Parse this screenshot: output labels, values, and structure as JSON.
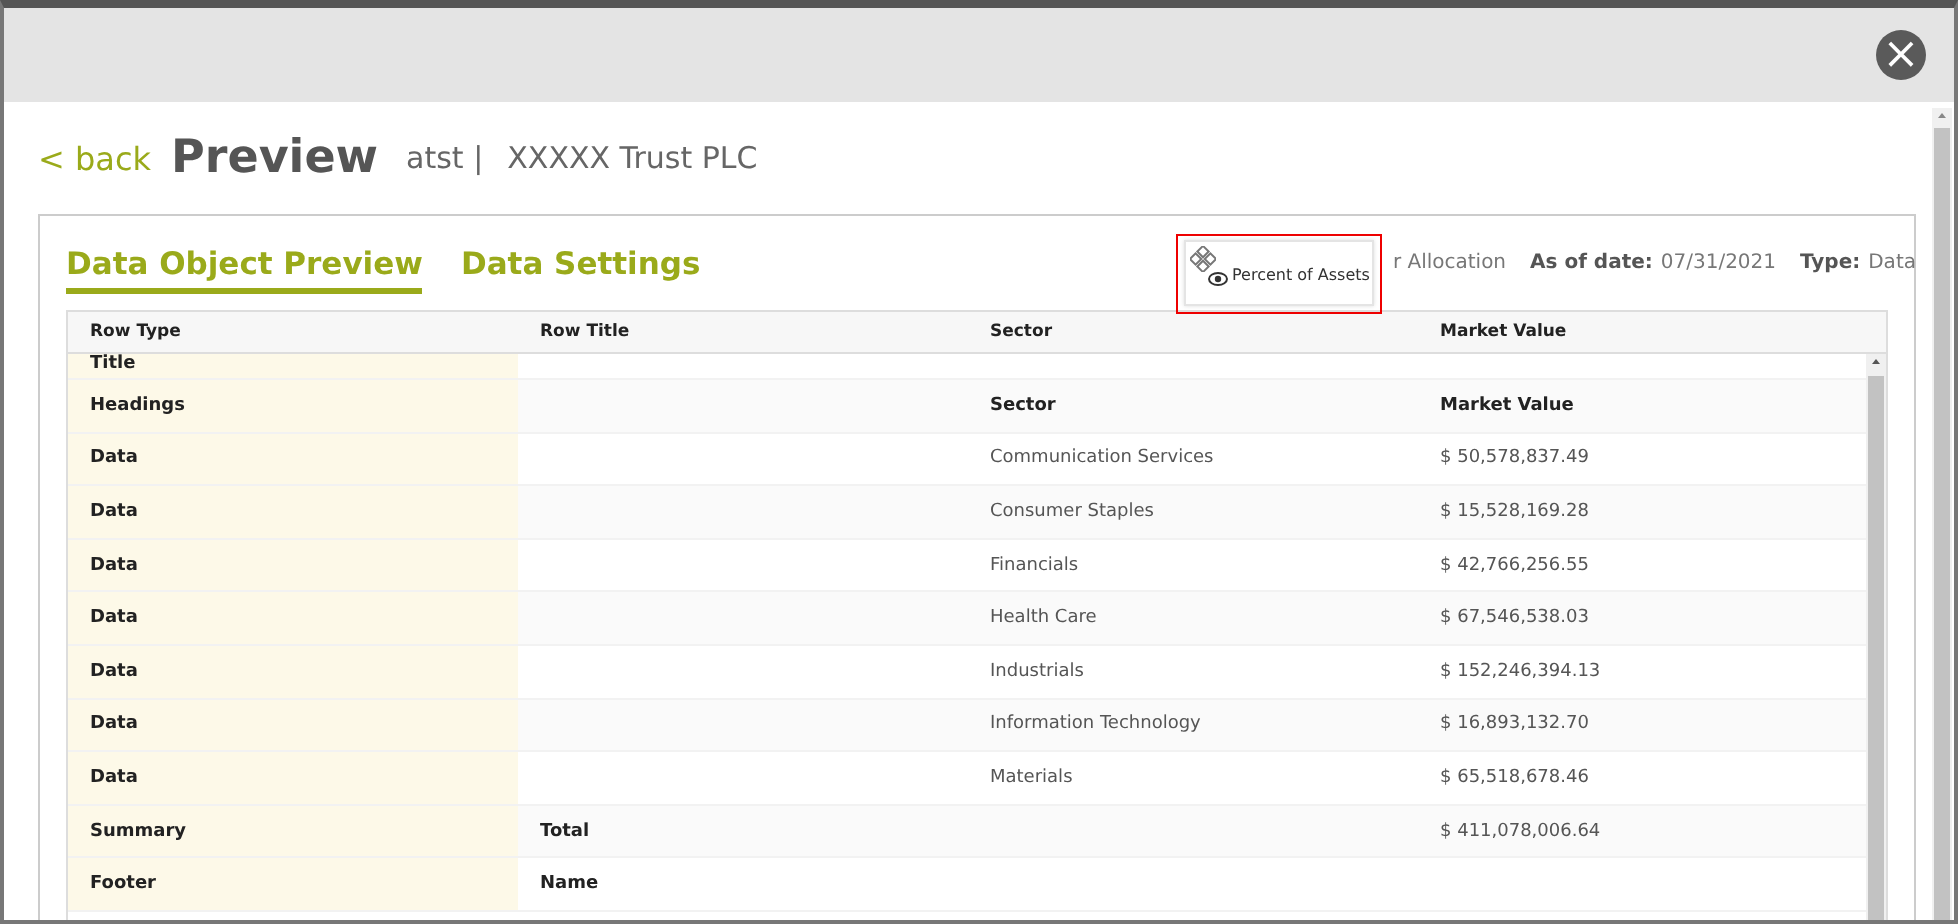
{
  "header": {
    "close_label": "×"
  },
  "page": {
    "back": "< back",
    "title": "Preview",
    "subtitle": "atst |",
    "entity": "XXXXX  Trust PLC"
  },
  "tabs": [
    {
      "label": "Data Object Preview",
      "selected": true
    },
    {
      "label": "Data Settings",
      "selected": false
    }
  ],
  "info": {
    "partial_label": "r Allocation",
    "date_label": "As of date:",
    "date": "07/31/2021",
    "type_label": "Type:",
    "type": "Data"
  },
  "tooltip": {
    "text": "Percent of Assets",
    "highlighted": true
  },
  "table": {
    "columns": [
      "Row Type",
      "Row Title",
      "Sector",
      "Market Value"
    ],
    "rows": [
      {
        "kind": "title",
        "row_type": "Title",
        "row_title": "",
        "sector": "",
        "market_value": ""
      },
      {
        "kind": "headings",
        "row_type": "Headings",
        "row_title": "",
        "sector": "Sector",
        "market_value": "Market Value"
      },
      {
        "kind": "data",
        "row_type": "Data",
        "row_title": "",
        "sector": "Communication Services",
        "market_value": "$ 50,578,837.49"
      },
      {
        "kind": "data",
        "row_type": "Data",
        "row_title": "",
        "sector": "Consumer Staples",
        "market_value": "$ 15,528,169.28"
      },
      {
        "kind": "data",
        "row_type": "Data",
        "row_title": "",
        "sector": "Financials",
        "market_value": "$ 42,766,256.55"
      },
      {
        "kind": "data",
        "row_type": "Data",
        "row_title": "",
        "sector": "Health Care",
        "market_value": "$ 67,546,538.03"
      },
      {
        "kind": "data",
        "row_type": "Data",
        "row_title": "",
        "sector": "Industrials",
        "market_value": "$ 152,246,394.13"
      },
      {
        "kind": "data",
        "row_type": "Data",
        "row_title": "",
        "sector": "Information Technology",
        "market_value": "$ 16,893,132.70"
      },
      {
        "kind": "data",
        "row_type": "Data",
        "row_title": "",
        "sector": "Materials",
        "market_value": "$ 65,518,678.46"
      },
      {
        "kind": "summary",
        "row_type": "Summary",
        "row_title": "Total",
        "sector": "",
        "market_value": "$ 411,078,006.64"
      },
      {
        "kind": "footer",
        "row_type": "Footer",
        "row_title": "Name",
        "sector": "",
        "market_value": ""
      }
    ]
  }
}
